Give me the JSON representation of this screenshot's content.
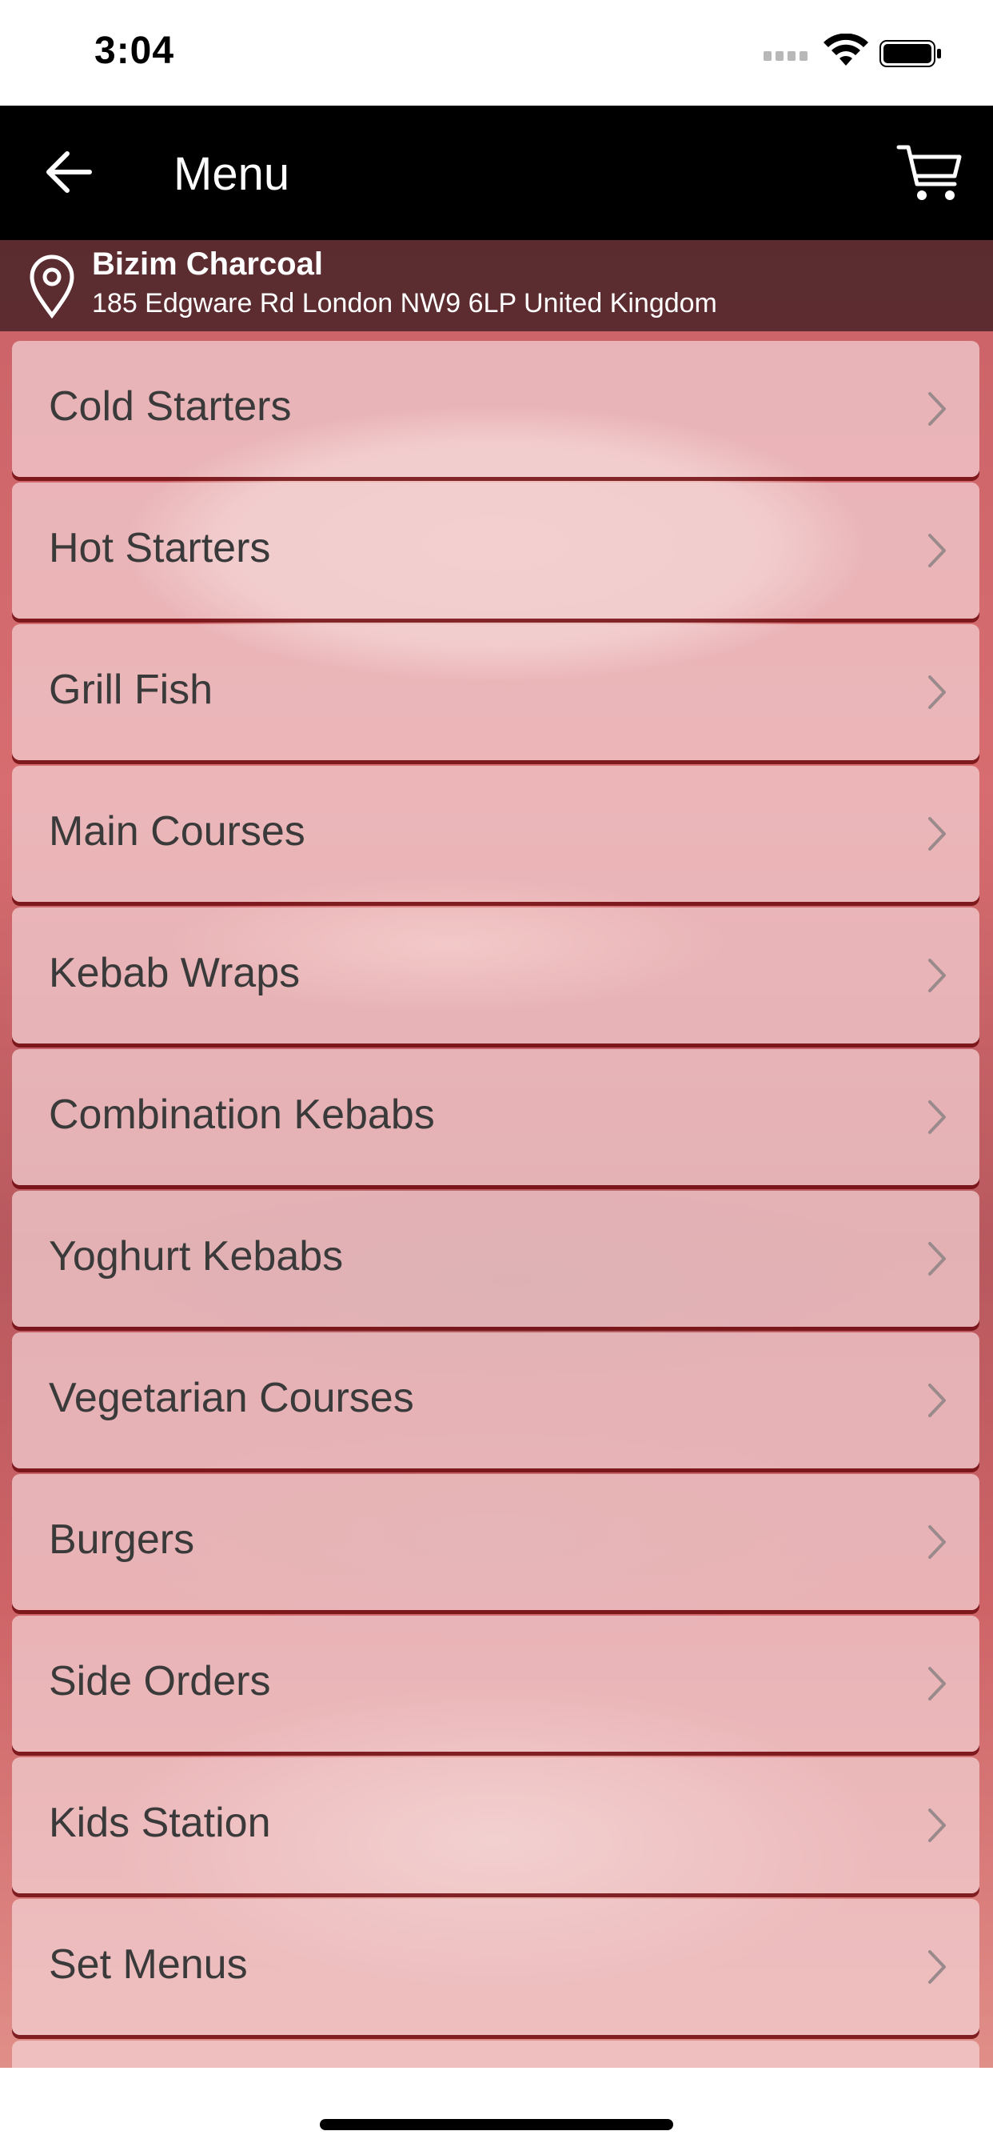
{
  "status_bar": {
    "time": "3:04"
  },
  "nav": {
    "title": "Menu",
    "back_icon": "arrow-left-icon",
    "cart_icon": "cart-icon"
  },
  "location": {
    "name": "Bizim Charcoal",
    "address": "185 Edgware Rd London NW9 6LP United Kingdom",
    "icon": "location-pin-icon"
  },
  "menu": {
    "items": [
      {
        "label": "Cold Starters"
      },
      {
        "label": "Hot Starters"
      },
      {
        "label": "Grill Fish"
      },
      {
        "label": "Main Courses"
      },
      {
        "label": "Kebab Wraps"
      },
      {
        "label": "Combination Kebabs"
      },
      {
        "label": "Yoghurt Kebabs"
      },
      {
        "label": "Vegetarian Courses"
      },
      {
        "label": "Burgers"
      },
      {
        "label": "Side Orders"
      },
      {
        "label": "Kids Station"
      },
      {
        "label": "Set Menus"
      },
      {
        "label": ""
      }
    ]
  },
  "colors": {
    "nav_background": "#000000",
    "text_primary": "#3a3a3a",
    "accent_red": "#b03033"
  }
}
